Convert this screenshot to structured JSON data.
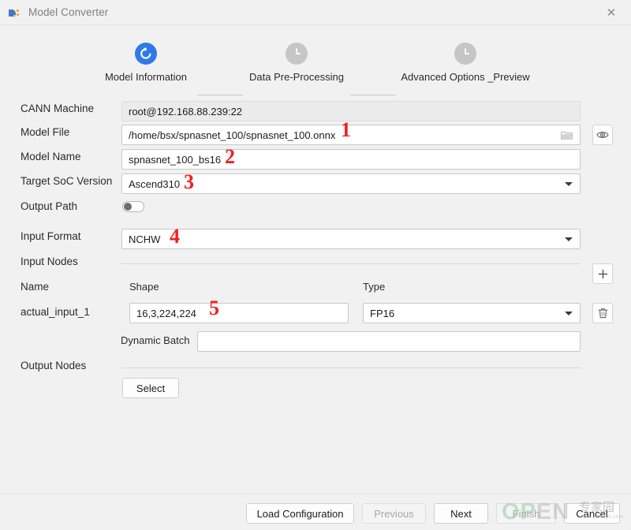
{
  "window": {
    "title": "Model Converter",
    "app_icon": "model-converter-logo-icon",
    "close_icon": "✕"
  },
  "stepper": {
    "steps": [
      {
        "label": "Model Information",
        "state": "active",
        "icon": "refresh-icon"
      },
      {
        "label": "Data Pre-Processing",
        "state": "inactive",
        "icon": "clock-icon"
      },
      {
        "label": "Advanced Options _Preview",
        "state": "inactive",
        "icon": "clock-icon"
      }
    ]
  },
  "form": {
    "cann_machine": {
      "label": "CANN Machine",
      "value": "root@192.168.88.239:22"
    },
    "model_file": {
      "label": "Model File",
      "value": "/home/bsx/spnasnet_100/spnasnet_100.onnx",
      "browse_icon": "folder-icon",
      "eye_icon": "eye-icon"
    },
    "model_name": {
      "label": "Model Name",
      "value": "spnasnet_100_bs16"
    },
    "target_soc_version": {
      "label": "Target SoC Version",
      "value": "Ascend310"
    },
    "output_path": {
      "label": "Output Path",
      "toggle_state": "off"
    },
    "input_format": {
      "label": "Input Format",
      "value": "NCHW"
    },
    "input_nodes": {
      "label": "Input Nodes",
      "add_icon": "plus-icon",
      "columns": {
        "name": "Name",
        "shape": "Shape",
        "type": "Type"
      },
      "rows": [
        {
          "name": "actual_input_1",
          "shape": "16,3,224,224",
          "type": "FP16",
          "delete_icon": "trash-icon"
        }
      ],
      "dynamic_batch": {
        "label": "Dynamic Batch",
        "value": ""
      }
    },
    "output_nodes": {
      "label": "Output Nodes",
      "select_button": "Select"
    }
  },
  "annotations": [
    {
      "id": "1",
      "target": "model-file-field"
    },
    {
      "id": "2",
      "target": "model-name-field"
    },
    {
      "id": "3",
      "target": "target-soc-version-field"
    },
    {
      "id": "4",
      "target": "input-format-field"
    },
    {
      "id": "5",
      "target": "shape-field"
    }
  ],
  "footer": {
    "load_configuration": "Load Configuration",
    "previous": "Previous",
    "next": "Next",
    "finish": "Finish",
    "cancel": "Cancel"
  },
  "watermark": {
    "open_text": "OPEN",
    "cn_text": "专家园",
    "url_text": "www.openjw.com",
    "color_green": "#9cc9a8",
    "color_gray": "#b9b9b9"
  },
  "colors": {
    "accent_blue": "#2f7ae5",
    "annotation_red": "#ef2121",
    "window_bg": "#f1f1f1"
  }
}
